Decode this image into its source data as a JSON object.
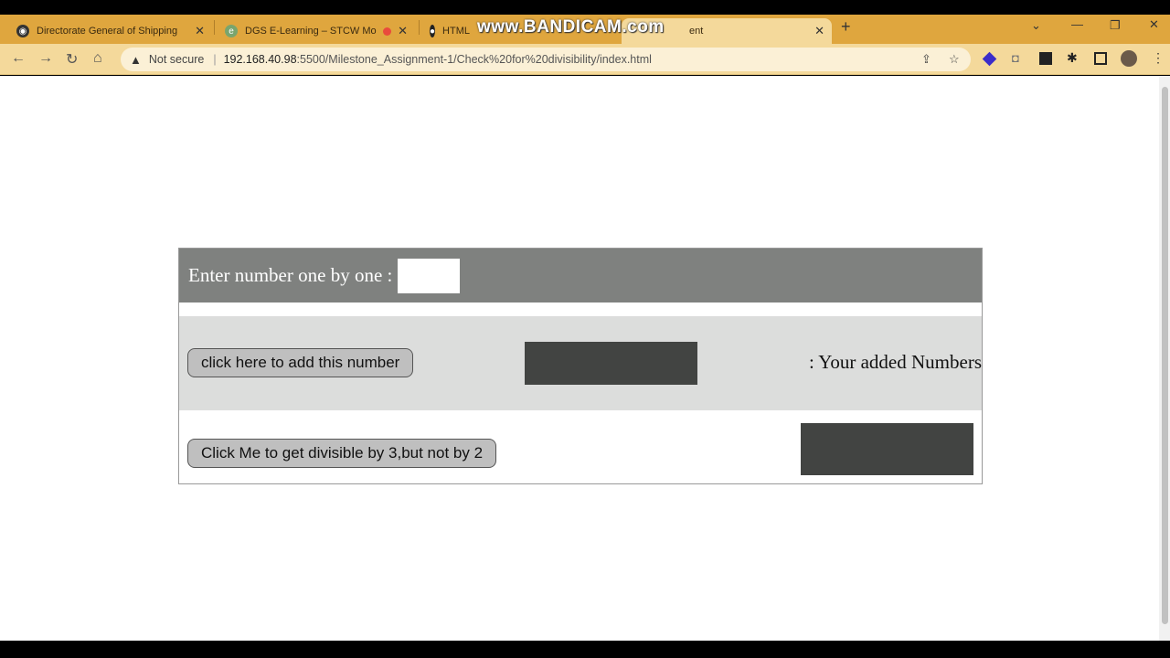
{
  "browser": {
    "tabs": [
      {
        "title": "Directorate General of Shipping",
        "favicon": "globe-icon"
      },
      {
        "title": "DGS E-Learning – STCW Mo",
        "favicon": "elearning-icon"
      },
      {
        "title": "HTML",
        "favicon": "github-icon"
      },
      {
        "title": "ent",
        "favicon": "page-icon"
      }
    ],
    "new_tab": "+",
    "security_label": "Not secure",
    "url_host": "192.168.40.98",
    "url_rest": ":5500/Milestone_Assignment-1/Check%20for%20divisibility/index.html",
    "watermark": "www.BANDICAM.com"
  },
  "page": {
    "input_label": "Enter number one by one :",
    "input_value": "",
    "add_button": "click here to add this number",
    "added_label": ": Your added Numbers",
    "divisible_button": "Click Me to get divisible by 3,but not by 2"
  },
  "colors": {
    "tabstrip": "#dfa63e",
    "header_row": "#7f817f",
    "middle_row": "#dcdddc",
    "output_box": "#424442"
  }
}
